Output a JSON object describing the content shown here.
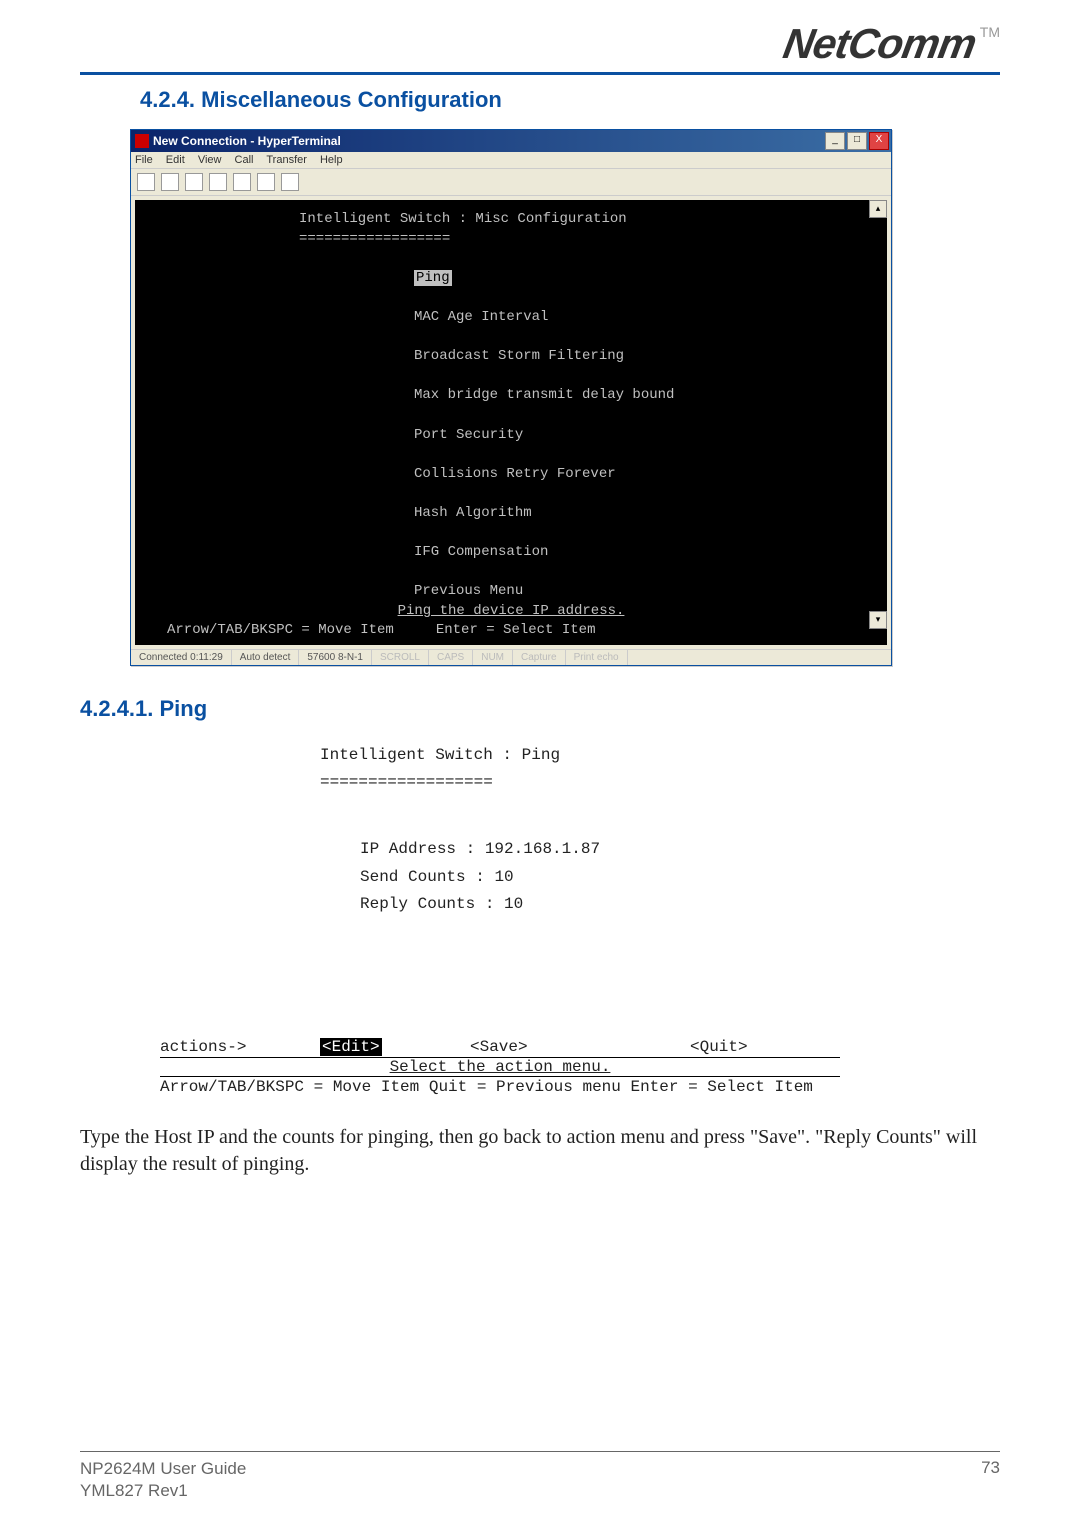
{
  "logo": {
    "text": "NetComm",
    "tm": "TM"
  },
  "section_heading": "4.2.4. Miscellaneous Configuration",
  "hyperterminal": {
    "title": "New Connection - HyperTerminal",
    "menus": [
      "File",
      "Edit",
      "View",
      "Call",
      "Transfer",
      "Help"
    ],
    "win_buttons": {
      "min": "_",
      "max": "□",
      "close": "X"
    },
    "scroll": {
      "up": "▴",
      "down": "▾"
    },
    "terminal": {
      "title_line": "Intelligent Switch : Misc Configuration",
      "underline": "==================",
      "items": [
        "Ping",
        "MAC Age Interval",
        "Broadcast Storm Filtering",
        "Max bridge transmit delay bound",
        "Port Security",
        "Collisions Retry Forever",
        "Hash Algorithm",
        "IFG Compensation",
        "Previous Menu"
      ],
      "hint": "Ping the device IP address.",
      "keys": "Arrow/TAB/BKSPC = Move Item     Enter = Select Item"
    },
    "status": {
      "connected": "Connected 0:11:29",
      "detect": "Auto detect",
      "baud": "57600 8-N-1",
      "scroll": "SCROLL",
      "caps": "CAPS",
      "num": "NUM",
      "capture": "Capture",
      "printecho": "Print echo"
    }
  },
  "sub_heading": "4.2.4.1. Ping",
  "ping_screen": {
    "title_line": "Intelligent Switch : Ping",
    "underline": "==================",
    "fields": {
      "ip_label": "IP Address   :",
      "ip_value": "192.168.1.87",
      "send_label": "Send Counts  :",
      "send_value": "10",
      "reply_label": "Reply Counts :",
      "reply_value": "10"
    },
    "actions": {
      "label": "actions->",
      "edit": "<Edit>",
      "save": "<Save>",
      "quit": "<Quit>",
      "hint": "Select the action menu.",
      "keys": "Arrow/TAB/BKSPC = Move Item   Quit = Previous menu   Enter = Select Item"
    }
  },
  "body_text": "Type the Host IP and the counts for pinging, then go back to action menu and press \"Save\". \"Reply Counts\" will display the result of pinging.",
  "footer": {
    "line1": "NP2624M User Guide",
    "line2": "YML827 Rev1",
    "page": "73"
  }
}
